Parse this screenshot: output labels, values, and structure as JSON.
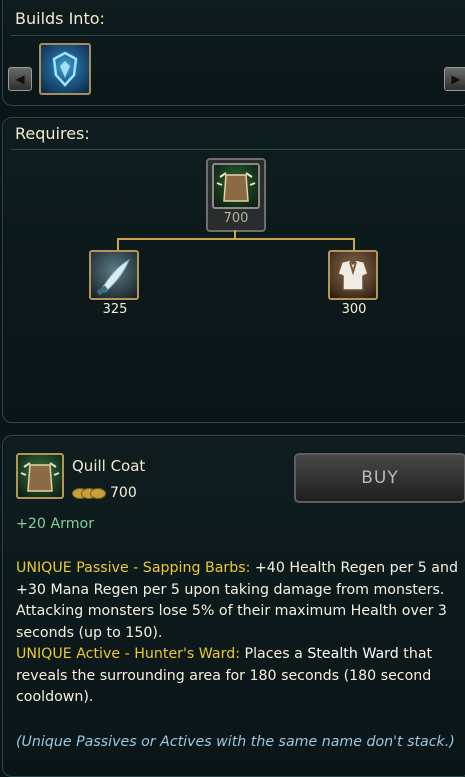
{
  "builds_into": {
    "title": "Builds Into:",
    "left_arrow": "◀",
    "right_arrow": "▶",
    "items": [
      {
        "icon": "blue-shield-item-icon"
      }
    ]
  },
  "requires": {
    "title": "Requires:",
    "root": {
      "icon": "quill-coat-icon",
      "cost": "700"
    },
    "children": [
      {
        "icon": "machete-icon",
        "cost": "325"
      },
      {
        "icon": "cloth-armor-icon",
        "cost": "300"
      }
    ]
  },
  "detail": {
    "name": "Quill Coat",
    "price": "700",
    "buy_label": "BUY",
    "stat": "+20 Armor",
    "passive_label": "UNIQUE Passive - Sapping Barbs:",
    "passive_text": "+40 Health Regen per 5 and +30 Mana Regen per 5 upon taking damage from monsters. Attacking monsters lose 5% of their maximum Health over 3 seconds (up to 150).",
    "active_label": "UNIQUE Active - Hunter's Ward:",
    "active_text_1": "Places a",
    "active_highlight": "Stealth Ward",
    "active_text_2": "that reveals the surrounding area for 180 seconds (180 second cooldown).",
    "note": "(Unique Passives or Actives with the same name don't stack.)"
  },
  "colors": {
    "gold_border": "#b39556",
    "unique": "#ecc92d",
    "stat": "#7fd09f",
    "note": "#9bc8e2"
  }
}
